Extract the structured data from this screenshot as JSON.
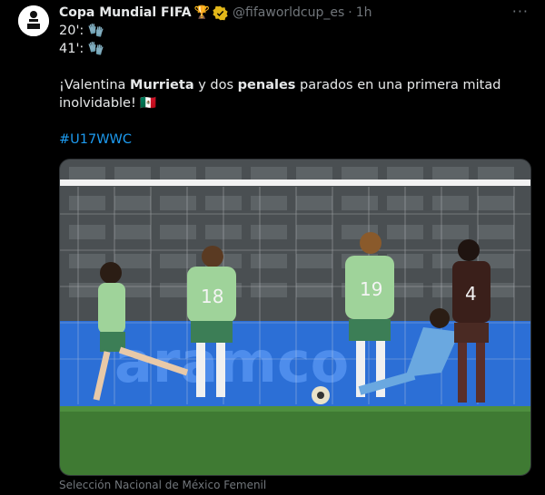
{
  "author": {
    "name": "Copa Mundial FIFA",
    "handle": "@fifaworldcup_es",
    "time": "1h",
    "badge_icon": "trophy-icon"
  },
  "tweet": {
    "line1": "20': 🧤",
    "line2": "41': 🧤",
    "sentence_start": "¡Valentina ",
    "sentence_bold1": "Murrieta",
    "sentence_mid": " y dos ",
    "sentence_bold2": "penales",
    "sentence_end": " parados en una primera mitad",
    "sentence_line2": "inolvidable! 🇲🇽",
    "hashtag": "#U17WWC"
  },
  "media": {
    "caption": "Selección Nacional de México Femenil",
    "player_numbers": [
      "18",
      "19",
      "4"
    ]
  },
  "colors": {
    "accent": "#1d9bf0",
    "muted": "#71767b",
    "verified": "#e2b719"
  }
}
